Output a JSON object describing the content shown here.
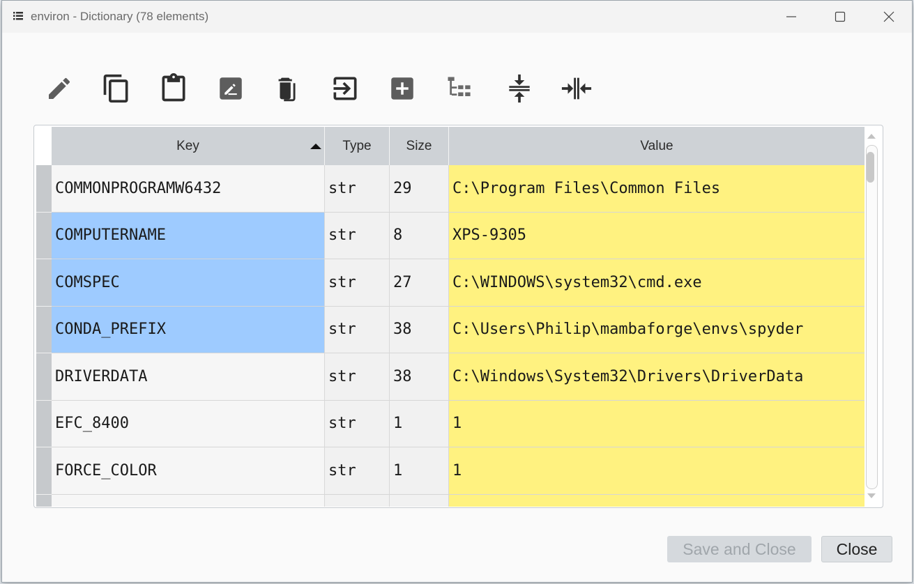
{
  "window": {
    "title": "environ - Dictionary (78 elements)",
    "icon": "list-icon",
    "controls": [
      "minimize-icon",
      "maximize-icon",
      "close-icon"
    ]
  },
  "toolbar": {
    "items": [
      {
        "name": "edit-icon"
      },
      {
        "name": "copy-icon"
      },
      {
        "name": "paste-icon"
      },
      {
        "name": "rename-icon"
      },
      {
        "name": "remove-icon"
      },
      {
        "name": "insert-icon"
      },
      {
        "name": "add-icon"
      },
      {
        "name": "view-tree-icon"
      },
      {
        "name": "collapse-icon"
      },
      {
        "name": "resize-columns-icon"
      }
    ]
  },
  "table": {
    "columns": {
      "key": "Key",
      "type": "Type",
      "size": "Size",
      "value": "Value"
    },
    "sort": {
      "column": "key",
      "direction": "ascending"
    },
    "rows": [
      {
        "key": "COMMONPROGRAMW6432",
        "type": "str",
        "size": "29",
        "value": "C:\\Program Files\\Common Files",
        "selected": false
      },
      {
        "key": "COMPUTERNAME",
        "type": "str",
        "size": "8",
        "value": "XPS-9305",
        "selected": true
      },
      {
        "key": "COMSPEC",
        "type": "str",
        "size": "27",
        "value": "C:\\WINDOWS\\system32\\cmd.exe",
        "selected": true
      },
      {
        "key": "CONDA_PREFIX",
        "type": "str",
        "size": "38",
        "value": "C:\\Users\\Philip\\mambaforge\\envs\\spyder",
        "selected": true
      },
      {
        "key": "DRIVERDATA",
        "type": "str",
        "size": "38",
        "value": "C:\\Windows\\System32\\Drivers\\DriverData",
        "selected": false
      },
      {
        "key": "EFC_8400",
        "type": "str",
        "size": "1",
        "value": "1",
        "selected": false
      },
      {
        "key": "FORCE_COLOR",
        "type": "str",
        "size": "1",
        "value": "1",
        "selected": false
      },
      {
        "key": "",
        "type": "",
        "size": "",
        "value": "",
        "selected": false
      }
    ]
  },
  "buttons": {
    "save_close": "Save and Close",
    "close": "Close"
  },
  "colors": {
    "selection": "#9ecbff",
    "value_cell": "#fff280",
    "header": "#ced2d6"
  }
}
